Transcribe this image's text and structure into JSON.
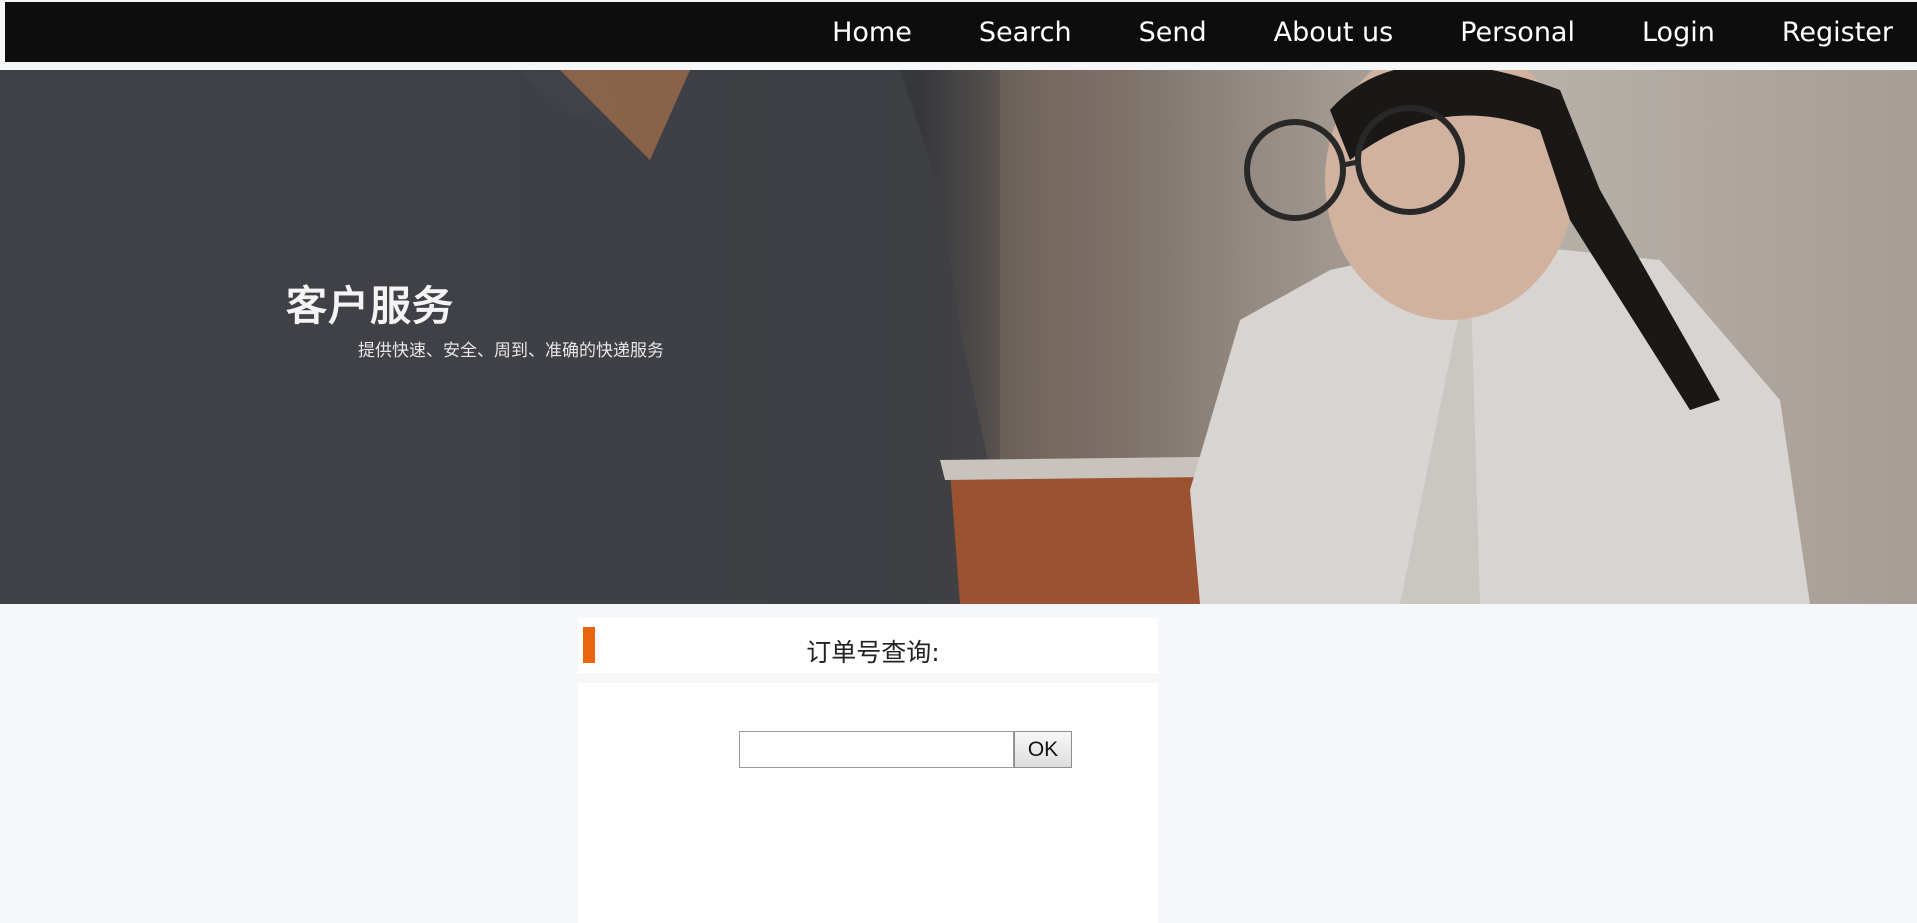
{
  "nav": {
    "items": [
      {
        "label": "Home"
      },
      {
        "label": "Search"
      },
      {
        "label": "Send"
      },
      {
        "label": "About us"
      },
      {
        "label": "Personal"
      },
      {
        "label": "Login"
      },
      {
        "label": "Register"
      }
    ]
  },
  "hero": {
    "title": "客户服务",
    "subtitle": "提供快速、安全、周到、准确的快递服务",
    "image_description_colors": {
      "jacket": "#3f4045",
      "orange_folder": "#b05a33",
      "shirt": "#ece8e4",
      "wall": "#b9aea4"
    }
  },
  "query": {
    "title": "订单号查询:",
    "accent_color": "#e9660f",
    "input_value": "",
    "input_placeholder": "",
    "button_label": "OK"
  }
}
